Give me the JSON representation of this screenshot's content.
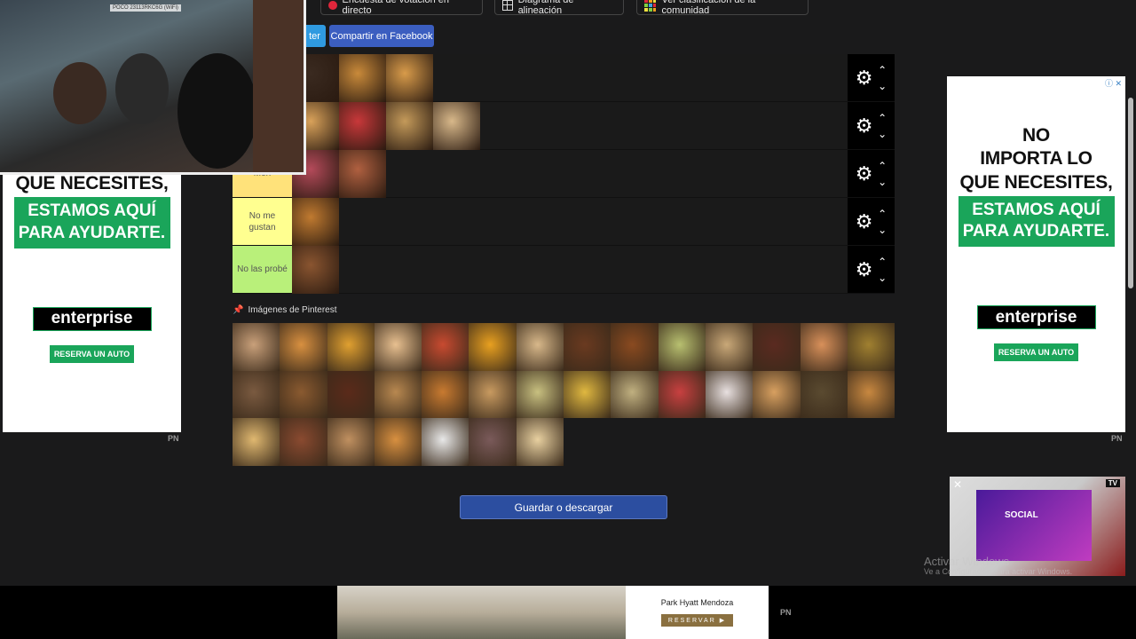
{
  "toolbar": {
    "live_vote_label": "Encuesta de votación en directo",
    "alignment_label": "Diagrama de alineación",
    "community_label": "Ver clasificación de la comunidad"
  },
  "share": {
    "twitter_label": "ter",
    "facebook_label": "Compartir en Facebook"
  },
  "tiers": [
    {
      "label": "",
      "color": "#ffffff",
      "items": [
        "#3a2a20",
        "#c98a3a",
        "#d89b4a"
      ]
    },
    {
      "label": "",
      "color": "#ffffff",
      "items": [
        "#d9a25a",
        "#c8383a",
        "#c49a5a",
        "#d8b88a"
      ]
    },
    {
      "label": "Meh",
      "color": "#ffe27a",
      "items": [
        "#b44a5a",
        "#b06040"
      ]
    },
    {
      "label": "No me gustan",
      "color": "#ffff90",
      "items": [
        "#c07a30"
      ]
    },
    {
      "label": "No las probé",
      "color": "#b9f07a",
      "items": [
        "#8a5530"
      ]
    }
  ],
  "pool": {
    "title": "Imágenes de Pinterest",
    "items": [
      "#c9a07a",
      "#d89040",
      "#e0a030",
      "#e8c090",
      "#c84a30",
      "#e8a020",
      "#d8b88a",
      "#6a3a20",
      "#8a4a20",
      "#b8c070",
      "#c9a878",
      "#5a2a20",
      "#d8905a",
      "#a08030",
      "#7a5a40",
      "#8a5a30",
      "#5a2a1a",
      "#b88850",
      "#c87a30",
      "#c89a60",
      "#c8c080",
      "#e0b840",
      "#c0b080",
      "#c84040",
      "#e8e0e0",
      "#d8a060",
      "#5a4a30",
      "#c88840",
      "#e0b870",
      "#8a4a30",
      "#c09060",
      "#d89040",
      "#e8e8e8",
      "#7a5a5a",
      "#e8d0a0"
    ]
  },
  "save_label": "Guardar o descargar",
  "side_ads": {
    "left": {
      "headline": "QUE NECESITES,",
      "green": "ESTAMOS AQUÍ\nPARA AYUDARTE.",
      "logo": "enterprise",
      "reserve": "RESERVA UN AUTO"
    },
    "right": {
      "headline": "NO\nIMPORTA LO\nQUE NECESITES,",
      "green": "ESTAMOS AQUÍ\nPARA AYUDARTE.",
      "logo": "enterprise",
      "reserve": "RESERVA UN AUTO"
    }
  },
  "pn_label": "PN",
  "webcam": {
    "device_tag": "POCO 23113RKC6G (WiFi)"
  },
  "video_ad": {
    "title": "SOCIAL",
    "tv": "TV"
  },
  "watermark": {
    "line1": "Activar Windows",
    "line2": "Ve a Configuración para activar Windows."
  },
  "bottom_ad": {
    "hotel": "Park Hyatt Mendoza",
    "cta": "RESERVAR ▶"
  }
}
